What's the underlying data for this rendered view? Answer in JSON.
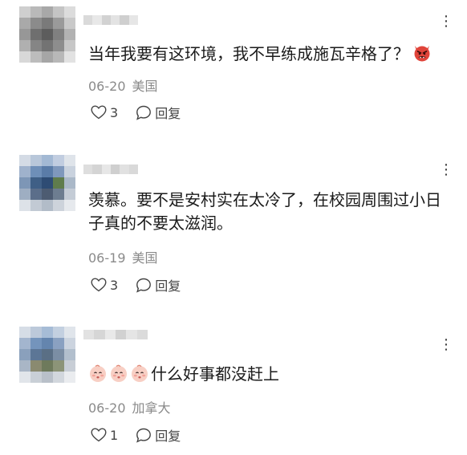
{
  "comments": [
    {
      "text": "当年我要有这环境，我不早练成施瓦辛格了？",
      "trailing_emoji": "devil-face",
      "date": "06-20",
      "location": "美国",
      "likes": "3",
      "reply_label": "回复",
      "avatar_colors": [
        "#cfcfcf",
        "#b9b9b9",
        "#a8a8a8",
        "#c4c4c4",
        "#dcdcdc",
        "#a9a9a9",
        "#8b8b8b",
        "#7a7a7a",
        "#9a9a9a",
        "#c9c9c9",
        "#979797",
        "#6f6f6f",
        "#5d5d5d",
        "#808080",
        "#b2b2b2",
        "#b0b0b0",
        "#858585",
        "#737373",
        "#8d8d8d",
        "#c7c7c7",
        "#d8d8d8",
        "#bcbcbc",
        "#a6a6a6",
        "#b8b8b8",
        "#e2e2e2"
      ],
      "name_colors": [
        "#dadada",
        "#e8e8e8",
        "#d2d2d2",
        "#e3e3e3",
        "#cfcfcf",
        "#e6e6e6"
      ]
    },
    {
      "text": "羡慕。要不是安村实在太冷了，在校园周围过小日子真的不要太滋润。",
      "date": "06-19",
      "location": "美国",
      "likes": "3",
      "reply_label": "回复",
      "avatar_colors": [
        "#d4dbe5",
        "#b8c7da",
        "#a3b9d4",
        "#c1cde0",
        "#dfe4ea",
        "#9fb2cc",
        "#6e8fb8",
        "#5a7ca8",
        "#7f98bc",
        "#c9d2de",
        "#7d96b6",
        "#3f5f86",
        "#2e4c74",
        "#5f7c4c",
        "#aab8c8",
        "#9eaec2",
        "#5b6e8a",
        "#4d5c72",
        "#6d7d90",
        "#c4ccd6",
        "#dde2e8",
        "#c2cad4",
        "#b2bcc8",
        "#cdd3db",
        "#e6e9ed"
      ],
      "name_colors": [
        "#dedede",
        "#d4d4d4",
        "#e7e7e7",
        "#cfcfcf",
        "#e1e1e1",
        "#d9d9d9"
      ]
    },
    {
      "text": "什么好事都没赶上",
      "leading_emoji_count": 3,
      "leading_emoji": "baby-face",
      "date": "06-20",
      "location": "加拿大",
      "likes": "1",
      "reply_label": "回复",
      "avatar_colors": [
        "#d6dde6",
        "#bcc9da",
        "#a6bcd6",
        "#c3d0e0",
        "#e0e5eb",
        "#a3b5ce",
        "#7494bc",
        "#6485ae",
        "#8aa1c1",
        "#ccd4df",
        "#8aa0bc",
        "#5c7696",
        "#5a6f85",
        "#7b8ea4",
        "#b2bfcd",
        "#a9b6c6",
        "#8a8a70",
        "#6e7a5c",
        "#8c9478",
        "#c8ced6",
        "#e1e5ea",
        "#c9cfd6",
        "#b9c0c9",
        "#d2d7dd",
        "#eaecef"
      ],
      "name_colors": [
        "#e2e2e2",
        "#d6d6d6",
        "#e9e9e9",
        "#d1d1d1",
        "#e5e5e5",
        "#dbdbdb"
      ]
    }
  ]
}
